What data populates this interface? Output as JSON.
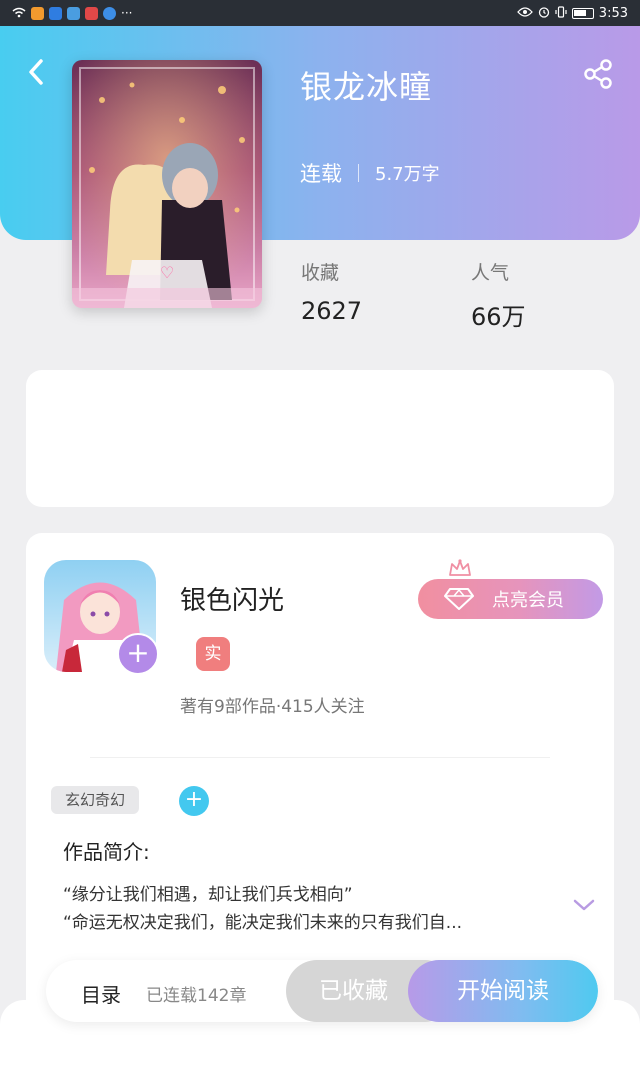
{
  "status_bar": {
    "time": "3:53",
    "overflow_dots": "···"
  },
  "book": {
    "title": "银龙冰瞳",
    "status": "连载",
    "word_count": "5.7万字",
    "stats": {
      "favorites_label": "收藏",
      "favorites_value": "2627",
      "popularity_label": "人气",
      "popularity_value": "66万"
    }
  },
  "author": {
    "name": "银色闪光",
    "badge": "实",
    "works_info": "著有9部作品·415人关注",
    "vip_button": "点亮会员",
    "avatar_add": "+"
  },
  "tags": [
    "玄幻奇幻"
  ],
  "tag_add": "+",
  "synopsis": {
    "title": "作品简介:",
    "lines": [
      "“缘分让我们相遇，却让我们兵戈相向”",
      "“命运无权决定我们，能决定我们未来的只有我们自..."
    ]
  },
  "bottom_bar": {
    "toc_label": "目录",
    "chapters_label": "已连载142章",
    "collected_label": "已收藏",
    "read_label": "开始阅读"
  },
  "colors": {
    "header_gradient": [
      "#48cdf0",
      "#8cb2ee",
      "#b99ae8"
    ],
    "vip_gradient": [
      "#f18fa0",
      "#c29ae6"
    ],
    "accent_blue": "#43c8ef",
    "badge_red": "#f07e7e",
    "purple": "#b38ae8"
  },
  "icons": [
    "back-arrow-icon",
    "share-icon",
    "diamond-icon",
    "crown-icon",
    "chevron-down-icon",
    "add-icon"
  ]
}
